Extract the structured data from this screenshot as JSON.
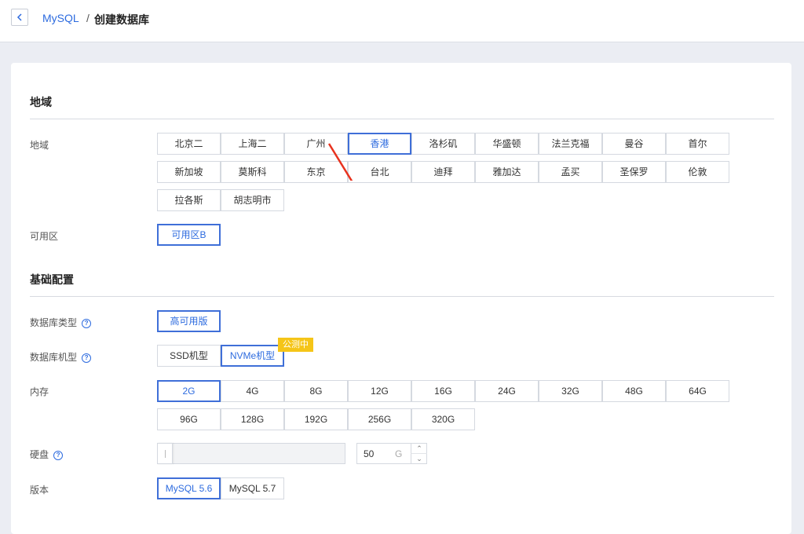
{
  "breadcrumb": {
    "parent": "MySQL",
    "separator": "/",
    "current": "创建数据库"
  },
  "region_section": {
    "title": "地域",
    "region_label": "地域",
    "regions": [
      "北京二",
      "上海二",
      "广州",
      "香港",
      "洛杉矶",
      "华盛顿",
      "法兰克福",
      "曼谷",
      "首尔",
      "新加坡",
      "莫斯科",
      "东京",
      "台北",
      "迪拜",
      "雅加达",
      "孟买",
      "圣保罗",
      "伦敦",
      "拉各斯",
      "胡志明市"
    ],
    "selected_region": "香港",
    "zone_label": "可用区",
    "zones": [
      "可用区B"
    ],
    "selected_zone": "可用区B"
  },
  "base_section": {
    "title": "基础配置",
    "db_type_label": "数据库类型",
    "db_types": [
      "高可用版"
    ],
    "selected_db_type": "高可用版",
    "machine_label": "数据库机型",
    "machines": [
      "SSD机型",
      "NVMe机型"
    ],
    "selected_machine": "NVMe机型",
    "beta_badge": "公测中",
    "memory_label": "内存",
    "memory_options": [
      "2G",
      "4G",
      "8G",
      "12G",
      "16G",
      "24G",
      "32G",
      "48G",
      "64G",
      "96G",
      "128G",
      "192G",
      "256G",
      "320G"
    ],
    "selected_memory": "2G",
    "disk_label": "硬盘",
    "disk_value": "50",
    "disk_unit": "G",
    "version_label": "版本",
    "versions": [
      "MySQL 5.6",
      "MySQL 5.7"
    ],
    "selected_version": "MySQL 5.6"
  },
  "colors": {
    "accent": "#2d6bdf",
    "badge": "#f5c518",
    "arrow": "#e8321e"
  },
  "icons": {
    "back": "chevron-left-icon",
    "help": "question-circle-icon",
    "up": "chevron-up-icon",
    "down": "chevron-down-icon"
  }
}
